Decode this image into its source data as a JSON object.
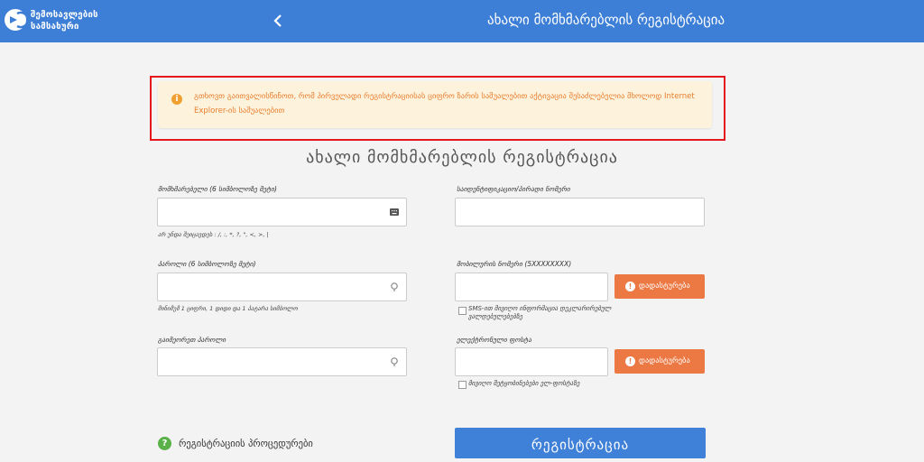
{
  "header": {
    "logo_line1": "შემოსავლების",
    "logo_line2": "სამსახური",
    "back_icon": "chevron-left-icon",
    "title": "ახალი მომხმარებლის რეგისტრაცია"
  },
  "notice": {
    "icon": "info-icon",
    "text": "გთხოვთ გაითვალისწინოთ, რომ პირველადი რეგისტრაციისას ციფრო ზარის საშუალებით აქტივაცია შესაძლებელია მხოლოდ Internet Explorer-ის საშუალებით"
  },
  "form": {
    "title": "ახალი მომხმარებლის რეგისტრაცია",
    "username": {
      "label": "მომხმარებელი (6 სიმბოლოზე მეტი)",
      "hint": "არ უნდა შეიცავდეს : /, :, *, ?, \", <, >, |",
      "value": ""
    },
    "password": {
      "label": "პაროლი (6 სიმბოლოზე მეტი)",
      "hint": "მინიმუმ 1 ციფრი, 1 დიდი და 1 პატარა სიმბოლო",
      "value": ""
    },
    "repeat_password": {
      "label": "გაიმეორეთ პაროლი",
      "value": ""
    },
    "id_number": {
      "label": "საიდენტიფიკაციო/პირადი ნომერი",
      "value": ""
    },
    "mobile": {
      "label": "მობილურის ნომერი (5XXXXXXXX)",
      "value": "",
      "confirm_label": "დადასტურება",
      "checkbox_label": "SMS-ით მივიღო ინფორმაცია დეკლარირებულ ვალდებულებებზე",
      "checked": false
    },
    "email": {
      "label": "ელექტრონული ფოსტა",
      "value": "",
      "confirm_label": "დადასტურება",
      "checkbox_label": "მივიღო შეტყობინებები ელ-ფოსტაზე",
      "checked": false
    },
    "help_icon": "question-icon",
    "help_label": "რეგისტრაციის პროცედურები",
    "submit_label": "რეგისტრაცია"
  },
  "colors": {
    "header": "#3d7fd6",
    "notice_bg": "#fdf3dd",
    "notice_text": "#e87c2c",
    "highlight_border": "#e3171c",
    "confirm_button": "#ec7843",
    "submit_button": "#3f80d8",
    "help_icon": "#5ab14a"
  }
}
